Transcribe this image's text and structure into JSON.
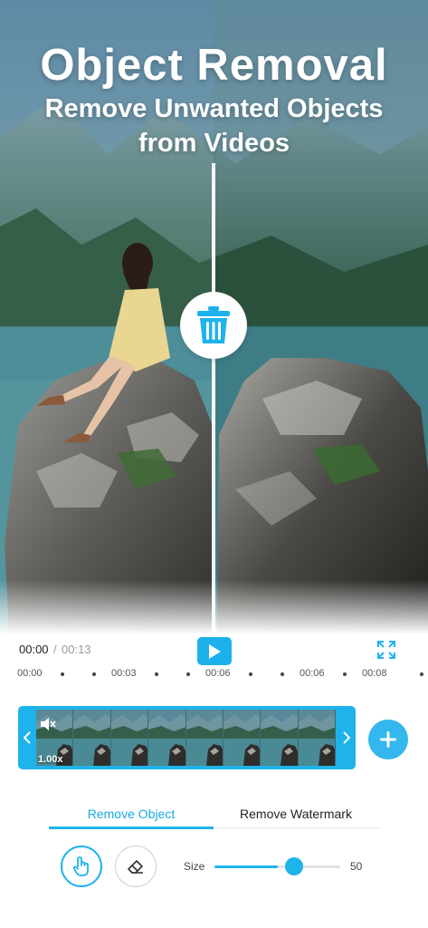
{
  "hero": {
    "title": "Object Removal",
    "subtitle_line1": "Remove Unwanted Objects",
    "subtitle_line2": "from Videos",
    "center_icon": "trash-icon"
  },
  "player": {
    "current_time": "00:00",
    "separator": "/",
    "total_time": "00:13",
    "play_icon": "play-icon",
    "fullscreen_icon": "fullscreen-icon"
  },
  "ruler": {
    "labels": [
      "00:00",
      "00:03",
      "00:06",
      "00:06",
      "00:08"
    ]
  },
  "timeline": {
    "speed": "1.00x",
    "frame_count": 8,
    "mute_icon": "mute-icon",
    "add_icon": "plus-icon"
  },
  "tabs": {
    "remove_object": "Remove Object",
    "remove_watermark": "Remove Watermark",
    "active": "remove_object"
  },
  "tools": {
    "finger_icon": "finger-touch-icon",
    "eraser_icon": "eraser-icon",
    "size_label": "Size",
    "size_value": "50",
    "size_fraction": 0.5
  },
  "colors": {
    "accent": "#1fb3ec",
    "accent_text": "#1aa9e3"
  }
}
